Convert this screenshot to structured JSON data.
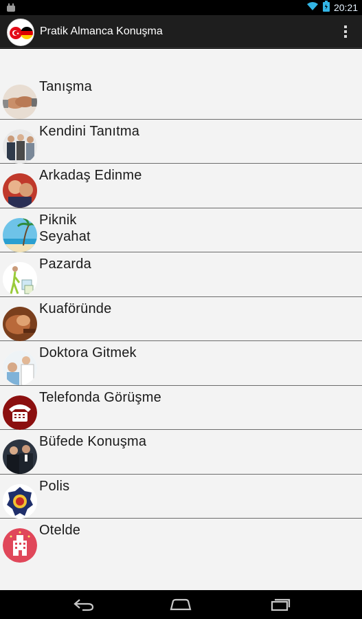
{
  "status_bar": {
    "time": "20:21",
    "icons": [
      "android-notification-icon",
      "wifi-icon",
      "battery-icon"
    ]
  },
  "action_bar": {
    "title": "Pratik Almanca Konuşma",
    "icon": "turkish-german-flags-icon",
    "overflow_icon": "overflow-menu-icon"
  },
  "list": {
    "items": [
      {
        "label": "Tanışma",
        "icon": "handshake-icon"
      },
      {
        "label": "Kendini Tanıtma",
        "icon": "people-group-icon"
      },
      {
        "label": "Arkadaş Edinme",
        "icon": "friends-icon"
      },
      {
        "label": "Piknik\nSeyahat",
        "icon": "beach-icon"
      },
      {
        "label": "Pazarda",
        "icon": "shopping-icon"
      },
      {
        "label": "Kuaföründe",
        "icon": "hairdresser-icon"
      },
      {
        "label": "Doktora Gitmek",
        "icon": "doctor-icon"
      },
      {
        "label": "Telefonda Görüşme",
        "icon": "telephone-icon"
      },
      {
        "label": "Büfede Konuşma",
        "icon": "business-people-icon"
      },
      {
        "label": "Polis",
        "icon": "police-badge-icon"
      },
      {
        "label": "Otelde",
        "icon": "hotel-icon"
      }
    ]
  },
  "nav_bar": {
    "back_icon": "back-icon",
    "home_icon": "home-icon",
    "recents_icon": "recents-icon"
  },
  "colors": {
    "action_bar_bg": "#1e1e1e",
    "list_bg": "#f3f3f3",
    "divider": "#6b6b6b",
    "status_text": "#e6f3ff"
  }
}
